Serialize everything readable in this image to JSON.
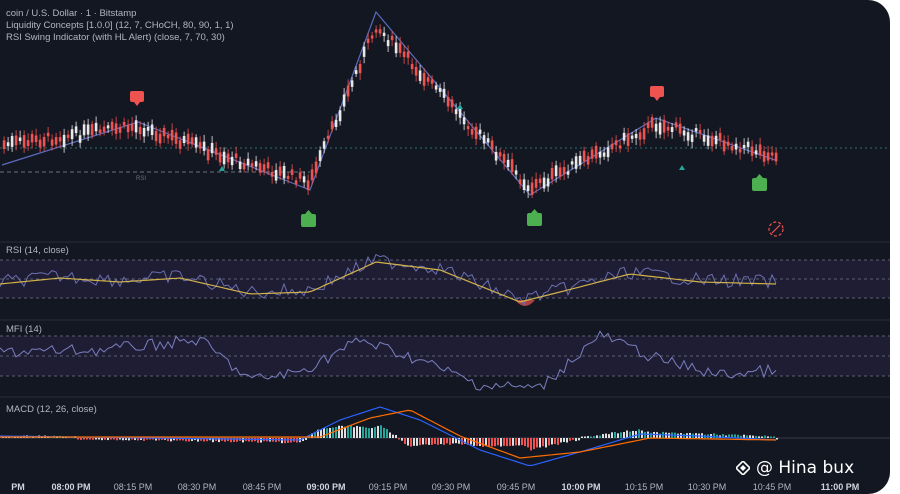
{
  "chart": {
    "title": "coin / U.S. Dollar · 1 · Bitstamp",
    "indicator_lines": [
      "Liquidity Concepts [1.0.0] (12, 7, CHoCH, 80, 90, 1, 1)",
      "RSI Swing Indicator (with HL Alert) (close, 7, 70, 30)"
    ],
    "colors": {
      "background": "#131722",
      "candle_down": "#ef5350",
      "candle_up": "#26a69a",
      "swing_line": "#5b6bbf",
      "signal_up": "#4caf50",
      "signal_down": "#ef5350"
    }
  },
  "panes": {
    "rsi_label": "RSI (14, close)",
    "mfi_label": "MFI (14)",
    "macd_label": "MACD (12, 26, close)",
    "small_mark": "RSI"
  },
  "time_axis": [
    {
      "label": "PM",
      "bold": true
    },
    {
      "label": "08:00 PM",
      "bold": true
    },
    {
      "label": "08:15 PM",
      "bold": false
    },
    {
      "label": "08:30 PM",
      "bold": false
    },
    {
      "label": "08:45 PM",
      "bold": false
    },
    {
      "label": "09:00 PM",
      "bold": true
    },
    {
      "label": "09:15 PM",
      "bold": false
    },
    {
      "label": "09:30 PM",
      "bold": false
    },
    {
      "label": "09:45 PM",
      "bold": false
    },
    {
      "label": "10:00 PM",
      "bold": true
    },
    {
      "label": "10:15 PM",
      "bold": false
    },
    {
      "label": "10:30 PM",
      "bold": false
    },
    {
      "label": "10:45 PM",
      "bold": false
    },
    {
      "label": "11:00 PM",
      "bold": true
    }
  ],
  "watermark": {
    "text": "@ Hina bux",
    "icon": "binance-diamond-icon"
  }
}
